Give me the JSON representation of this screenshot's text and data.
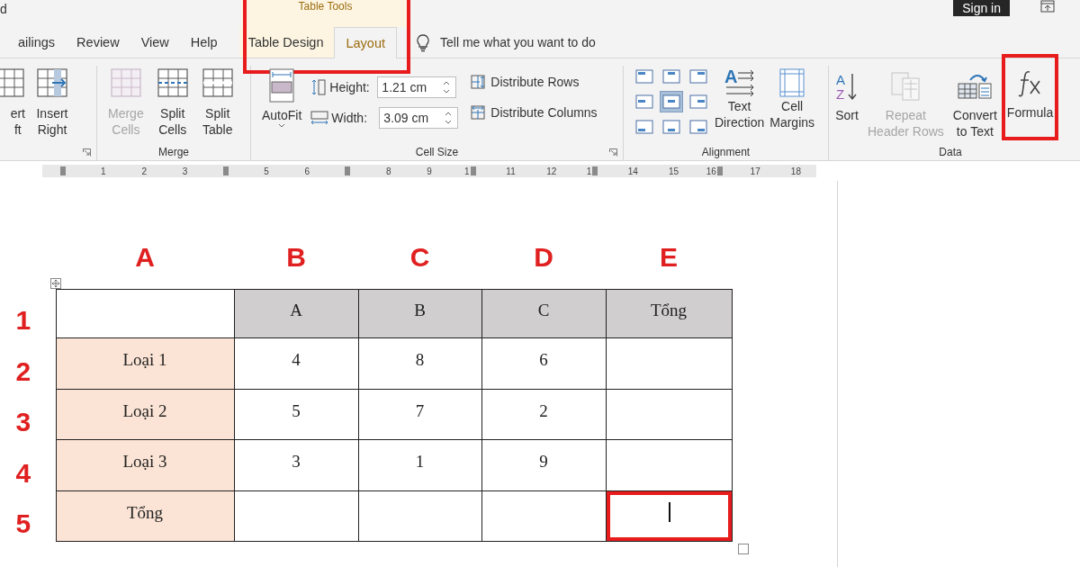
{
  "app": {
    "title": "d",
    "context_header": {
      "label": "Table Tools",
      "highlight": true
    },
    "sign_in": "Sign in"
  },
  "tabs": [
    {
      "label": "ailings",
      "selected": false,
      "contextual": false
    },
    {
      "label": "Review",
      "selected": false,
      "contextual": false
    },
    {
      "label": "View",
      "selected": false,
      "contextual": false
    },
    {
      "label": "Help",
      "selected": false,
      "contextual": false
    },
    {
      "label": "Table Design",
      "selected": false,
      "contextual": true
    },
    {
      "label": "Layout",
      "selected": true,
      "contextual": true
    }
  ],
  "tell_me": {
    "placeholder": "Tell me what you want to do"
  },
  "ribbon": {
    "rows_columns": {
      "launcher": true,
      "buttons": [
        {
          "lines": [
            "ert",
            "ft"
          ],
          "disabled": false
        },
        {
          "lines": [
            "Insert",
            "Right"
          ],
          "disabled": false
        }
      ]
    },
    "merge": {
      "label": "Merge",
      "buttons": [
        {
          "lines": [
            "Merge",
            "Cells"
          ],
          "disabled": true
        },
        {
          "lines": [
            "Split",
            "Cells"
          ],
          "disabled": false
        },
        {
          "lines": [
            "Split",
            "Table"
          ],
          "disabled": false
        }
      ]
    },
    "cell_size": {
      "label": "Cell Size",
      "launcher": true,
      "autofit": "AutoFit",
      "height": {
        "label": "Height:",
        "value": "1.21 cm"
      },
      "width": {
        "label": "Width:",
        "value": "3.09 cm"
      },
      "distribute": [
        "Distribute Rows",
        "Distribute Columns"
      ]
    },
    "alignment": {
      "label": "Alignment",
      "align_buttons": [
        {
          "selected": false
        },
        {
          "selected": false
        },
        {
          "selected": false
        },
        {
          "selected": false
        },
        {
          "selected": true
        },
        {
          "selected": false
        },
        {
          "selected": false
        },
        {
          "selected": false
        },
        {
          "selected": false
        }
      ],
      "buttons": [
        {
          "lines": [
            "Text",
            "Direction"
          ],
          "icon_letters": [
            "A"
          ]
        },
        {
          "lines": [
            "Cell",
            "Margins"
          ]
        }
      ]
    },
    "data": {
      "label": "Data",
      "buttons": [
        {
          "lines": [
            "Sort"
          ],
          "disabled": false,
          "highlight": false,
          "icon_letters": [
            "A",
            "Z"
          ]
        },
        {
          "lines": [
            "Repeat",
            "Header Rows"
          ],
          "disabled": true,
          "highlight": false
        },
        {
          "lines": [
            "Convert",
            "to Text"
          ],
          "disabled": false,
          "highlight": false
        },
        {
          "lines": [
            "Formula"
          ],
          "disabled": false,
          "highlight": true
        }
      ]
    }
  },
  "ruler": [
    {
      "kind": "marker"
    },
    {
      "kind": "number",
      "label": "1"
    },
    {
      "kind": "number",
      "label": "2"
    },
    {
      "kind": "number",
      "label": "3"
    },
    {
      "kind": "marker"
    },
    {
      "kind": "number",
      "label": "5"
    },
    {
      "kind": "number",
      "label": "6"
    },
    {
      "kind": "marker"
    },
    {
      "kind": "number",
      "label": "8"
    },
    {
      "kind": "number",
      "label": "9"
    },
    {
      "kind": "number_marker",
      "label": "1"
    },
    {
      "kind": "number",
      "label": "11"
    },
    {
      "kind": "number",
      "label": "12"
    },
    {
      "kind": "number_marker",
      "label": "1"
    },
    {
      "kind": "number",
      "label": "14"
    },
    {
      "kind": "number",
      "label": "15"
    },
    {
      "kind": "number_marker",
      "label": "16"
    },
    {
      "kind": "number",
      "label": "17"
    },
    {
      "kind": "number",
      "label": "18"
    }
  ],
  "column_letters": [
    "A",
    "B",
    "C",
    "D",
    "E"
  ],
  "row_numbers": [
    "1",
    "2",
    "3",
    "4",
    "5"
  ],
  "table": {
    "rows": [
      [
        {
          "kind": "plain",
          "highlight": false,
          "cursor": false
        },
        {
          "text": "A",
          "kind": "header",
          "highlight": false,
          "cursor": false
        },
        {
          "text": "B",
          "kind": "header",
          "highlight": false,
          "cursor": false
        },
        {
          "text": "C",
          "kind": "header",
          "highlight": false,
          "cursor": false
        },
        {
          "text": "Tổng",
          "kind": "header",
          "highlight": false,
          "cursor": false
        }
      ],
      [
        {
          "text": "Loại 1",
          "kind": "label",
          "highlight": false,
          "cursor": false
        },
        {
          "text": "4",
          "kind": "plain",
          "highlight": false,
          "cursor": false
        },
        {
          "text": "8",
          "kind": "plain",
          "highlight": false,
          "cursor": false
        },
        {
          "text": "6",
          "kind": "plain",
          "highlight": false,
          "cursor": false
        },
        {
          "kind": "plain",
          "highlight": false,
          "cursor": false
        }
      ],
      [
        {
          "text": "Loại 2",
          "kind": "label",
          "highlight": false,
          "cursor": false
        },
        {
          "text": "5",
          "kind": "plain",
          "highlight": false,
          "cursor": false
        },
        {
          "text": "7",
          "kind": "plain",
          "highlight": false,
          "cursor": false
        },
        {
          "text": "2",
          "kind": "plain",
          "highlight": false,
          "cursor": false
        },
        {
          "kind": "plain",
          "highlight": false,
          "cursor": false
        }
      ],
      [
        {
          "text": "Loại 3",
          "kind": "label",
          "highlight": false,
          "cursor": false
        },
        {
          "text": "3",
          "kind": "plain",
          "highlight": false,
          "cursor": false
        },
        {
          "text": "1",
          "kind": "plain",
          "highlight": false,
          "cursor": false
        },
        {
          "text": "9",
          "kind": "plain",
          "highlight": false,
          "cursor": false
        },
        {
          "kind": "plain",
          "highlight": false,
          "cursor": false
        }
      ],
      [
        {
          "text": "Tổng",
          "kind": "label",
          "highlight": false,
          "cursor": false
        },
        {
          "kind": "plain",
          "highlight": false,
          "cursor": false
        },
        {
          "kind": "plain",
          "highlight": false,
          "cursor": false
        },
        {
          "kind": "plain",
          "highlight": false,
          "cursor": false
        },
        {
          "kind": "plain",
          "highlight": true,
          "cursor": true
        }
      ]
    ]
  }
}
